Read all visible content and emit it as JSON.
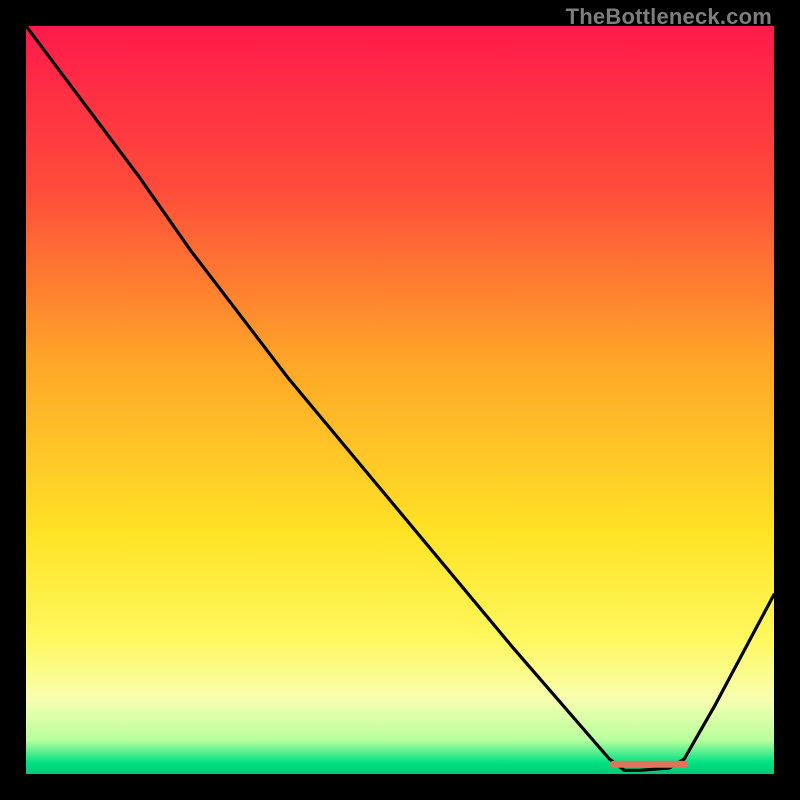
{
  "attribution": "TheBottleneck.com",
  "chart_data": {
    "type": "line",
    "title": "",
    "xlabel": "",
    "ylabel": "",
    "xlim": [
      0,
      100
    ],
    "ylim": [
      0,
      100
    ],
    "background": {
      "type": "vertical-gradient",
      "stops": [
        {
          "pos": 0.0,
          "color": "#ff1a4b"
        },
        {
          "pos": 0.22,
          "color": "#ff4d3a"
        },
        {
          "pos": 0.45,
          "color": "#ffa628"
        },
        {
          "pos": 0.68,
          "color": "#ffe326"
        },
        {
          "pos": 0.82,
          "color": "#fff85e"
        },
        {
          "pos": 0.9,
          "color": "#f7ffb0"
        },
        {
          "pos": 0.955,
          "color": "#b7ff9e"
        },
        {
          "pos": 0.985,
          "color": "#00e183"
        },
        {
          "pos": 1.0,
          "color": "#00c878"
        }
      ]
    },
    "series": [
      {
        "name": "bottleneck-curve",
        "color": "#000000",
        "x": [
          0,
          6,
          15,
          22,
          35,
          50,
          65,
          78,
          80,
          82,
          86,
          88,
          92,
          100
        ],
        "y": [
          100,
          92,
          80,
          70,
          53,
          35,
          17,
          2,
          0.5,
          0.5,
          0.8,
          2,
          9,
          24
        ]
      }
    ],
    "markers": [
      {
        "name": "optimal-band",
        "type": "segment",
        "color": "#e2725b",
        "x": [
          78.5,
          88
        ],
        "y": [
          1.3,
          1.3
        ],
        "thickness": 7
      }
    ]
  }
}
